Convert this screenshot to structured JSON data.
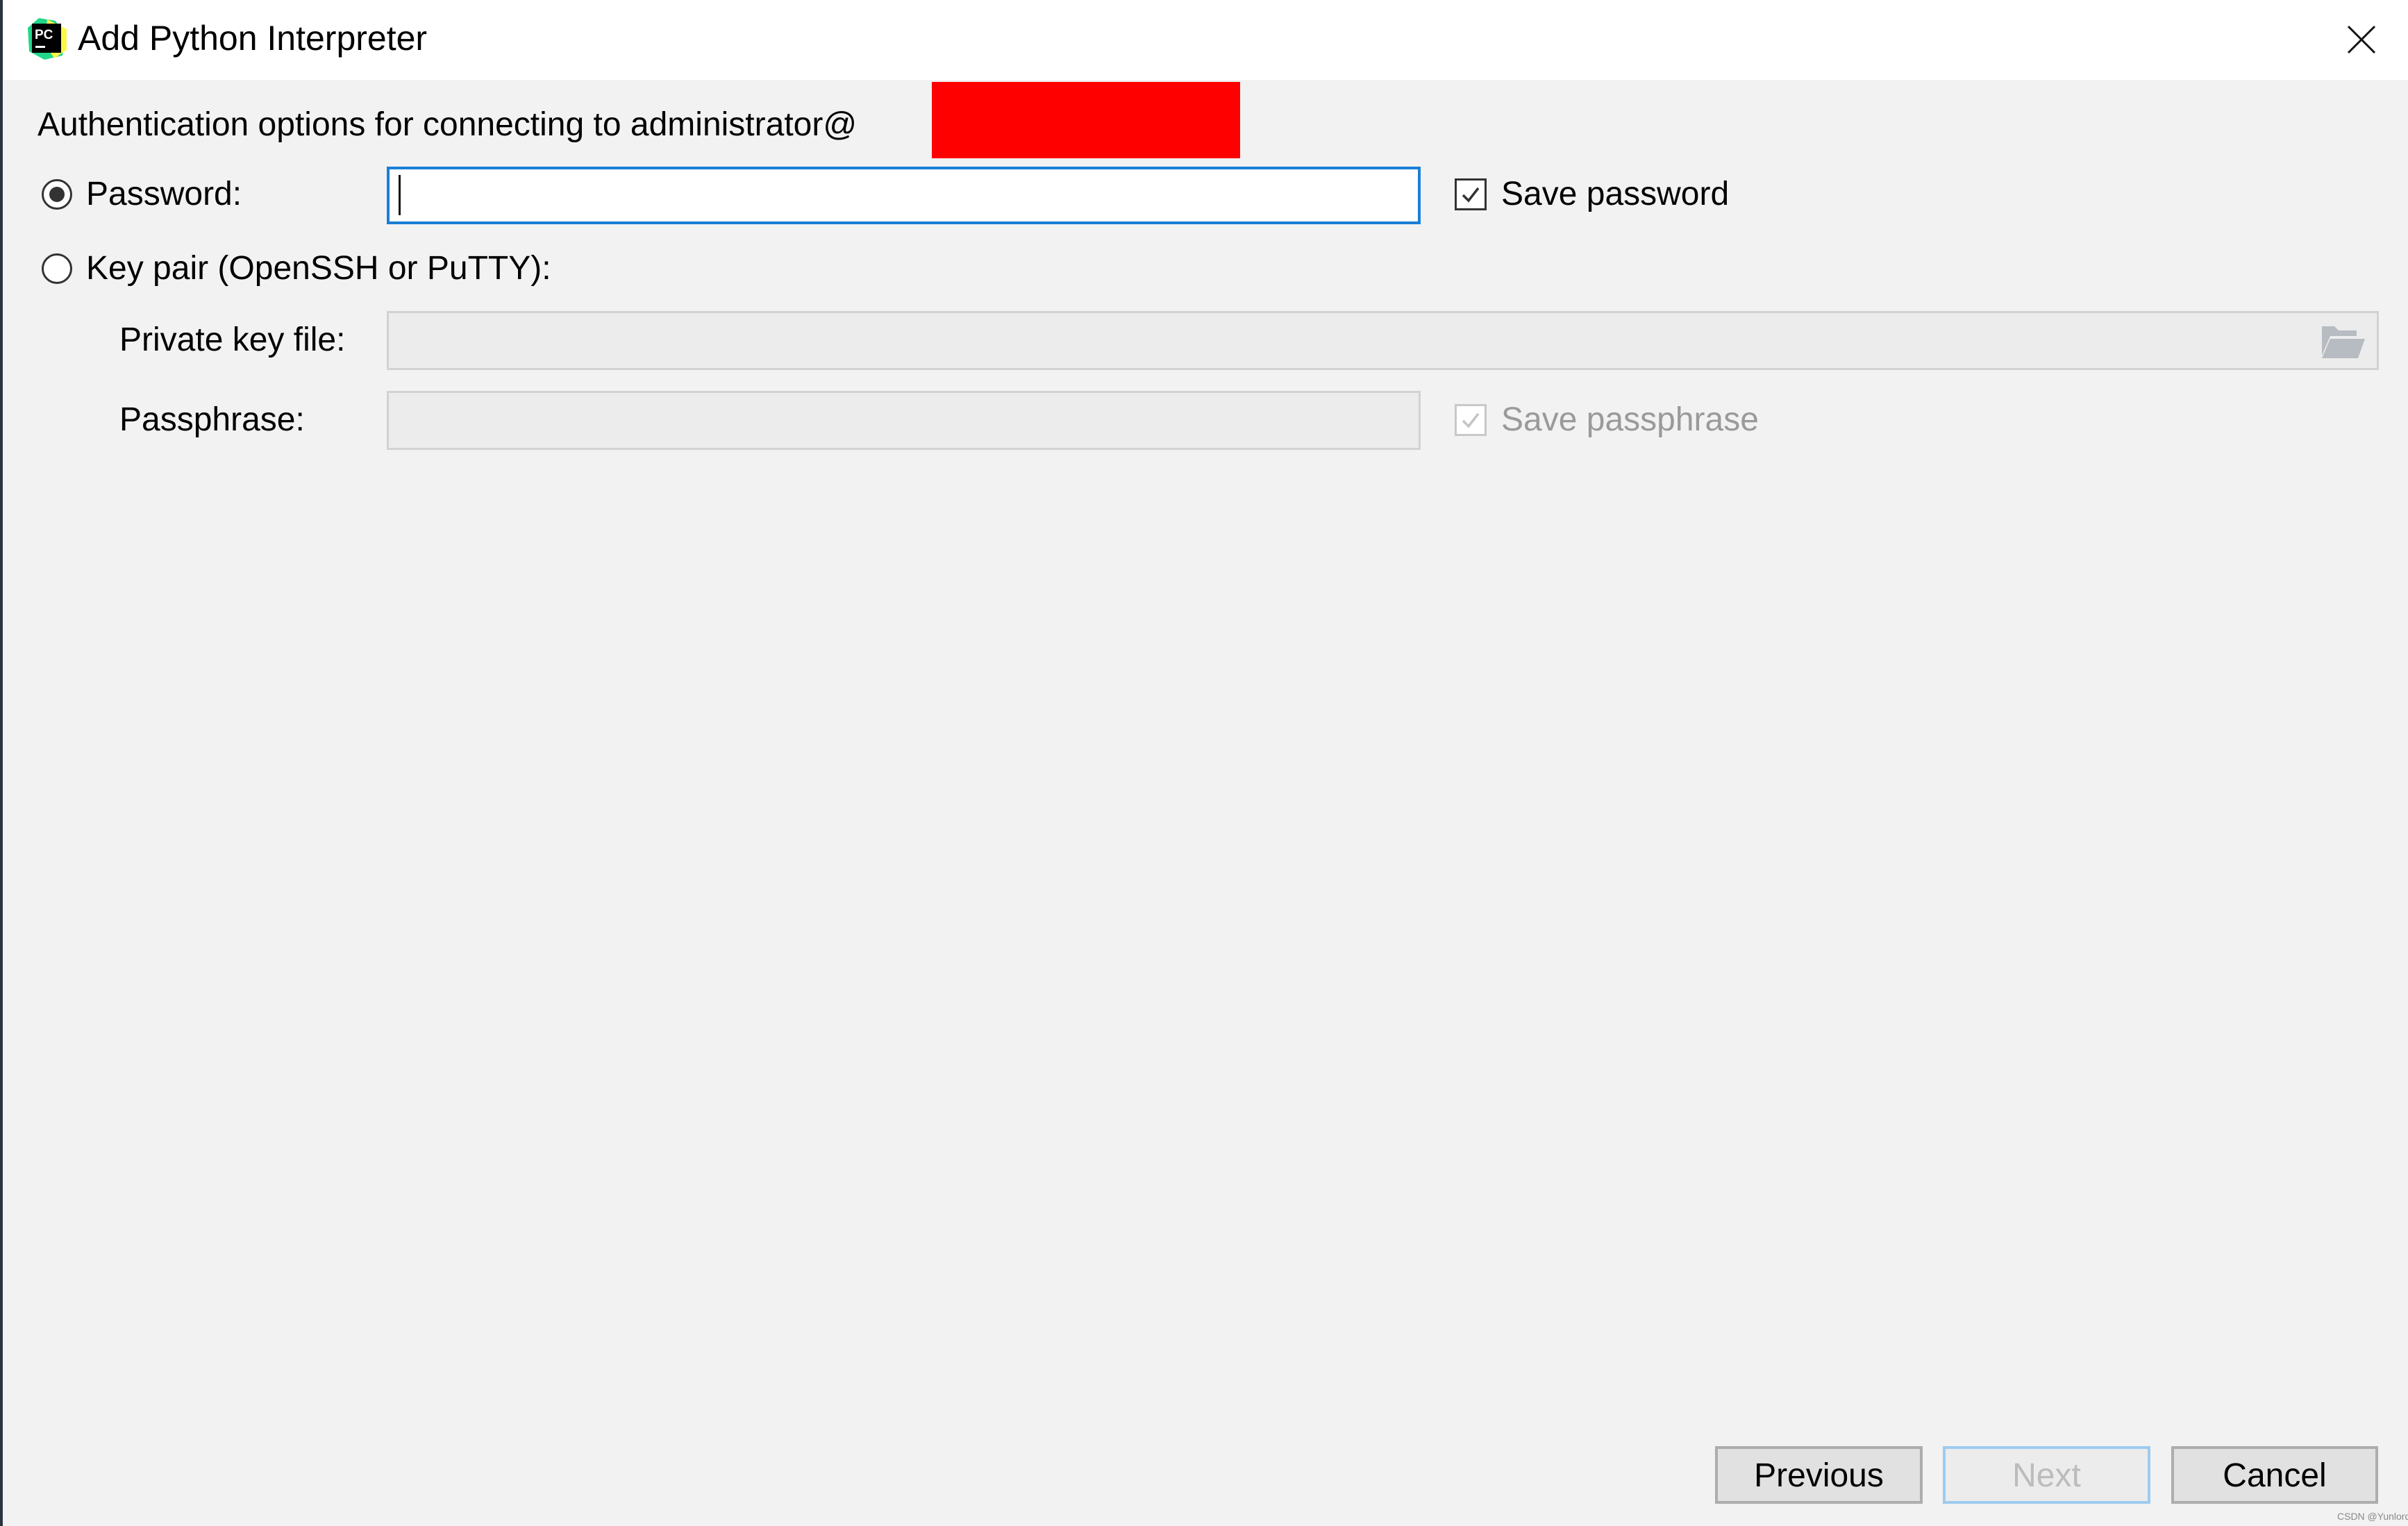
{
  "window": {
    "title": "Add Python Interpreter",
    "app_icon": "pycharm-logo-icon",
    "close_icon": "close-icon"
  },
  "auth": {
    "heading": "Authentication options for connecting to administrator@",
    "host_redacted": true,
    "redaction_color": "#ff0000",
    "selected_method": "password",
    "password_option": {
      "label": "Password:",
      "selected": true,
      "value": "",
      "save_label": "Save password",
      "save_checked": true
    },
    "keypair_option": {
      "label": "Key pair (OpenSSH or PuTTY):",
      "selected": false,
      "private_key_label": "Private key file:",
      "private_key_value": "",
      "browse_icon": "folder-open-icon",
      "passphrase_label": "Passphrase:",
      "passphrase_value": "",
      "save_passphrase_label": "Save passphrase",
      "save_passphrase_checked": true,
      "enabled": false
    }
  },
  "footer": {
    "previous_label": "Previous",
    "next_label": "Next",
    "next_enabled": false,
    "cancel_label": "Cancel"
  },
  "watermark": "CSDN @Yunlord",
  "colors": {
    "accent_focus": "#1a7fd6",
    "background": "#f2f2f2",
    "titlebar": "#ffffff"
  }
}
